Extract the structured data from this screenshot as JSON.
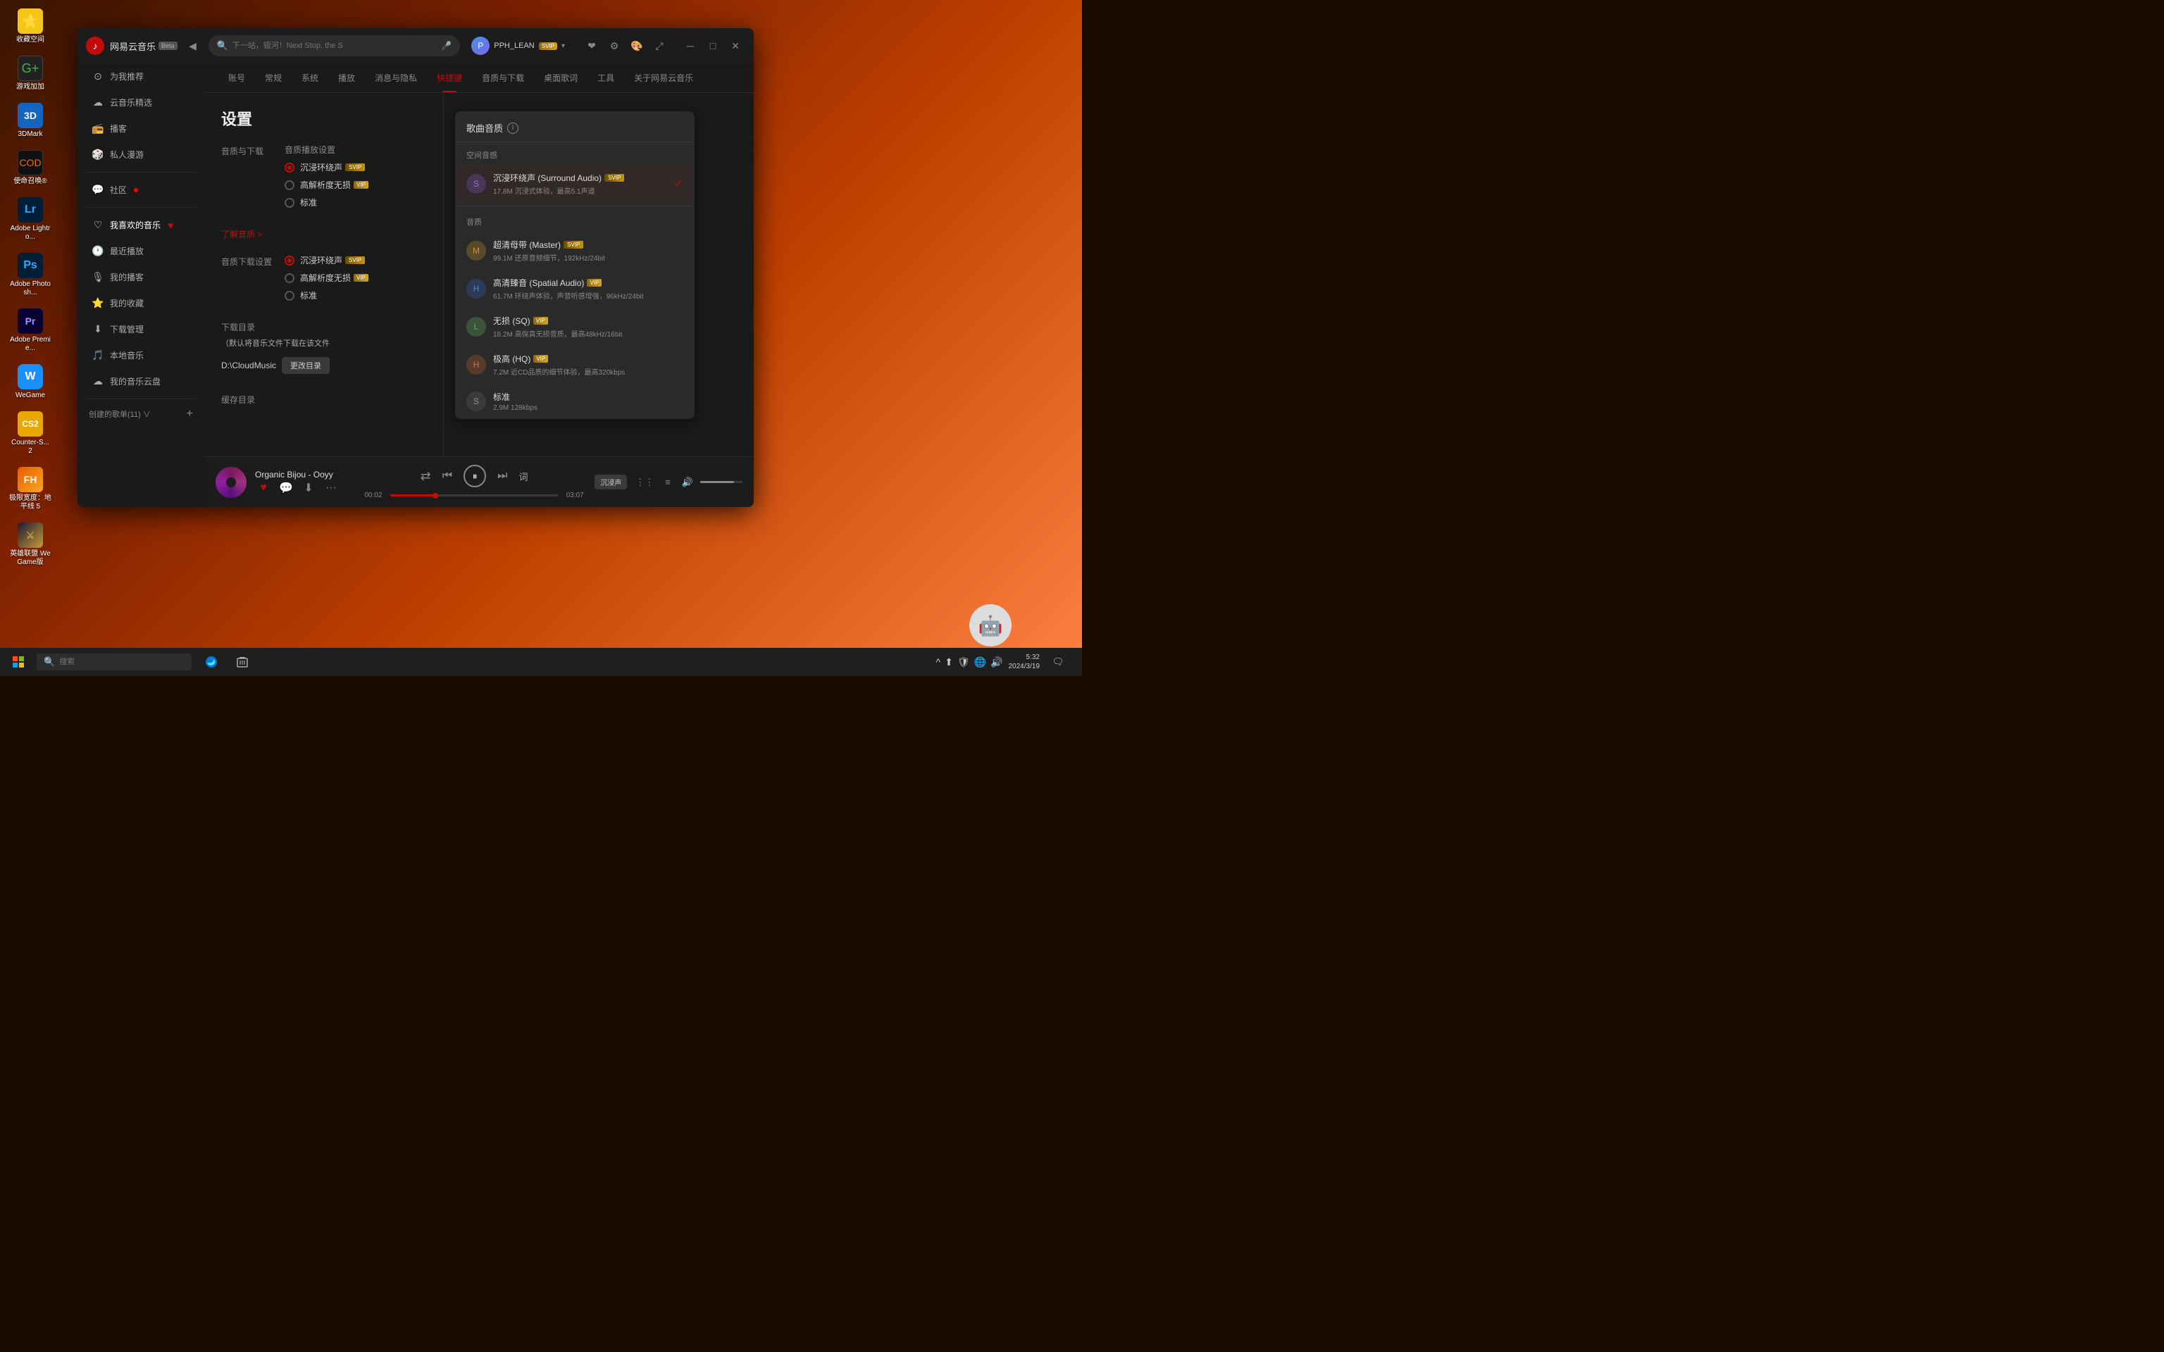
{
  "desktop": {
    "icons": [
      {
        "id": "favorites",
        "label": "收藏空间",
        "emoji": "⭐",
        "color": "#f5c518"
      },
      {
        "id": "gameplus",
        "label": "游戏加加",
        "emoji": "🎮",
        "color": "#4caf50"
      },
      {
        "id": "3dmark",
        "label": "3DMark",
        "emoji": "3",
        "color": "#1565c0"
      },
      {
        "id": "cod",
        "label": "使命召唤®",
        "emoji": "🎯",
        "color": "#1a1a1a"
      },
      {
        "id": "lightroom",
        "label": "Adobe Lightro...",
        "emoji": "L",
        "color": "#31a8ff"
      },
      {
        "id": "photoshop",
        "label": "Adobe Photosh...",
        "emoji": "P",
        "color": "#31a8ff"
      },
      {
        "id": "premiere",
        "label": "Adobe Premie...",
        "emoji": "Pr",
        "color": "#9999ff"
      },
      {
        "id": "wegame",
        "label": "WeGame",
        "emoji": "W",
        "color": "#1890ff"
      },
      {
        "id": "counter",
        "label": "Counter-Strik...",
        "emoji": "CS",
        "color": "#f0a830"
      },
      {
        "id": "forza",
        "label": "极限宽度：地平线 5",
        "emoji": "🏎",
        "color": "#e65c00"
      },
      {
        "id": "yleague",
        "label": "英雄联盟 WeGame版",
        "emoji": "⚔",
        "color": "#c89b3c"
      }
    ]
  },
  "taskbar": {
    "search_placeholder": "搜索",
    "apps": [
      {
        "id": "edge",
        "emoji": "🌐",
        "active": true
      },
      {
        "id": "recycle",
        "emoji": "🗑",
        "active": false
      }
    ],
    "systray": {
      "arrow": "^",
      "icons": [
        "⬆",
        "W",
        "🌐",
        "🔊"
      ],
      "clock_time": "5:32",
      "clock_date": "2024/3/19"
    }
  },
  "app": {
    "title": "网易云音乐",
    "beta_label": "Beta",
    "search_placeholder": "下一站，银河！Next Stop, the S",
    "user_name": "PPH_LEAN",
    "svip_label": "SVIP",
    "nav_back": "◀",
    "nav_forward": "▶",
    "sidebar": {
      "items": [
        {
          "id": "recommend",
          "label": "为我推荐",
          "icon": "⊙"
        },
        {
          "id": "cloud",
          "label": "云音乐精选",
          "icon": "☁"
        },
        {
          "id": "podcast",
          "label": "播客",
          "icon": "📻"
        },
        {
          "id": "manga",
          "label": "私人漫游",
          "icon": "🎲"
        },
        {
          "id": "community",
          "label": "社区",
          "icon": "💬",
          "badge": true
        },
        {
          "id": "liked",
          "label": "我喜欢的音乐",
          "icon": "♡"
        },
        {
          "id": "recent",
          "label": "最近播放",
          "icon": "🕐"
        },
        {
          "id": "mycast",
          "label": "我的播客",
          "icon": "🎙"
        },
        {
          "id": "collect",
          "label": "我的收藏",
          "icon": "⭐"
        },
        {
          "id": "download",
          "label": "下载管理",
          "icon": "⬇"
        },
        {
          "id": "local",
          "label": "本地音乐",
          "icon": "🎵"
        },
        {
          "id": "disk",
          "label": "我的音乐云盘",
          "icon": "☁"
        }
      ],
      "playlist_section": "创建的歌单(11)",
      "playlist_add": "+"
    },
    "tabs": [
      {
        "id": "account",
        "label": "账号"
      },
      {
        "id": "general",
        "label": "常规"
      },
      {
        "id": "system",
        "label": "系统"
      },
      {
        "id": "playback",
        "label": "播放"
      },
      {
        "id": "message",
        "label": "消息与隐私"
      },
      {
        "id": "shortcut",
        "label": "快捷键",
        "active": true
      },
      {
        "id": "quality",
        "label": "音质与下载",
        "active": false
      },
      {
        "id": "desktop_lyrics",
        "label": "桌面歌词"
      },
      {
        "id": "tools",
        "label": "工具"
      },
      {
        "id": "about",
        "label": "关于网易云音乐"
      }
    ],
    "settings": {
      "page_title": "设置",
      "audio_quality_section": "音质与下载",
      "quality_playback_label": "音质播放设置",
      "quality_download_label": "音质下载设置",
      "options": {
        "surround": "沉浸环绕声",
        "hires": "高解析度无损",
        "standard": "标准"
      },
      "download_path_label": "下载目录",
      "download_path_info": "（默认将音乐文件下载在该文件",
      "download_path_value": "D:\\CloudMusic",
      "change_btn": "更改目录",
      "cache_dir_label": "缓存目录",
      "learn_more": "了解音质 >"
    },
    "quality_panel": {
      "title": "歌曲音质",
      "info_icon": "i",
      "spatial_label": "空间音感",
      "audio_label": "音质",
      "options": [
        {
          "id": "surround",
          "name": "沉浸环绕声 (Surround Audio)",
          "svip": true,
          "desc": "17.8M 沉浸式体验，最高5.1声道",
          "selected": true,
          "icon_type": "surround",
          "icon": "S"
        },
        {
          "id": "master",
          "name": "超清母带 (Master)",
          "svip": true,
          "desc": "99.1M 还原音频细节，192kHz/24bit",
          "selected": false,
          "icon_type": "master",
          "icon": "M"
        },
        {
          "id": "spatial",
          "name": "高清臻音 (Spatial Audio)",
          "vip": true,
          "desc": "61.7M 环绕声体验，声音听感增强，96kHz/24bit",
          "selected": false,
          "icon_type": "spatial",
          "icon": "H"
        },
        {
          "id": "lossless",
          "name": "无损 (SQ)",
          "vip": true,
          "desc": "18.2M 高保真无损音质，最高48kHz/16bit",
          "selected": false,
          "icon_type": "lossless",
          "icon": "L"
        },
        {
          "id": "high",
          "name": "极高 (HQ)",
          "vip": true,
          "desc": "7.2M 近CD品质的细节体验，最高320kbps",
          "selected": false,
          "icon_type": "high",
          "icon": "H"
        },
        {
          "id": "standard",
          "name": "标准",
          "desc": "2.9M 128kbps",
          "selected": false,
          "icon_type": "standard",
          "icon": "S"
        }
      ]
    },
    "player": {
      "song": "Organic Bijou",
      "separator": "-",
      "title": "Ooyy",
      "time_current": "00:02",
      "time_total": "03:07",
      "progress_percent": 27,
      "immersive_btn": "沉浸声",
      "shuffle": "⇄",
      "prev": "⏮",
      "play": "⏸",
      "next": "⏭",
      "lyrics": "词"
    }
  }
}
